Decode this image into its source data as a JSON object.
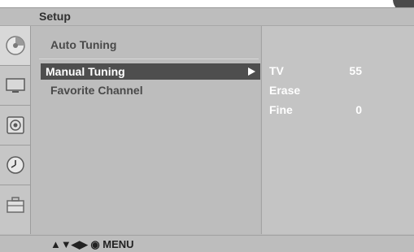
{
  "title": "Setup",
  "icons": [
    "setup-disc-icon",
    "picture-tv-icon",
    "audio-speaker-icon",
    "time-clock-icon",
    "option-toolbox-icon"
  ],
  "menu": {
    "items": [
      {
        "label": "Auto Tuning"
      },
      {
        "label": "Manual Tuning",
        "selected": true
      },
      {
        "label": "Favorite Channel"
      }
    ]
  },
  "submenu": {
    "rows": [
      {
        "label": "TV",
        "value": "55"
      },
      {
        "label": "Erase",
        "value": ""
      },
      {
        "label": "Fine",
        "value": "0"
      }
    ]
  },
  "footer": {
    "hint": "▲▼◀▶ ◉ MENU"
  },
  "colors": {
    "selected_bg": "#4e4e4e",
    "panel_bg": "#bdbdbd",
    "text_white": "#ffffff"
  }
}
